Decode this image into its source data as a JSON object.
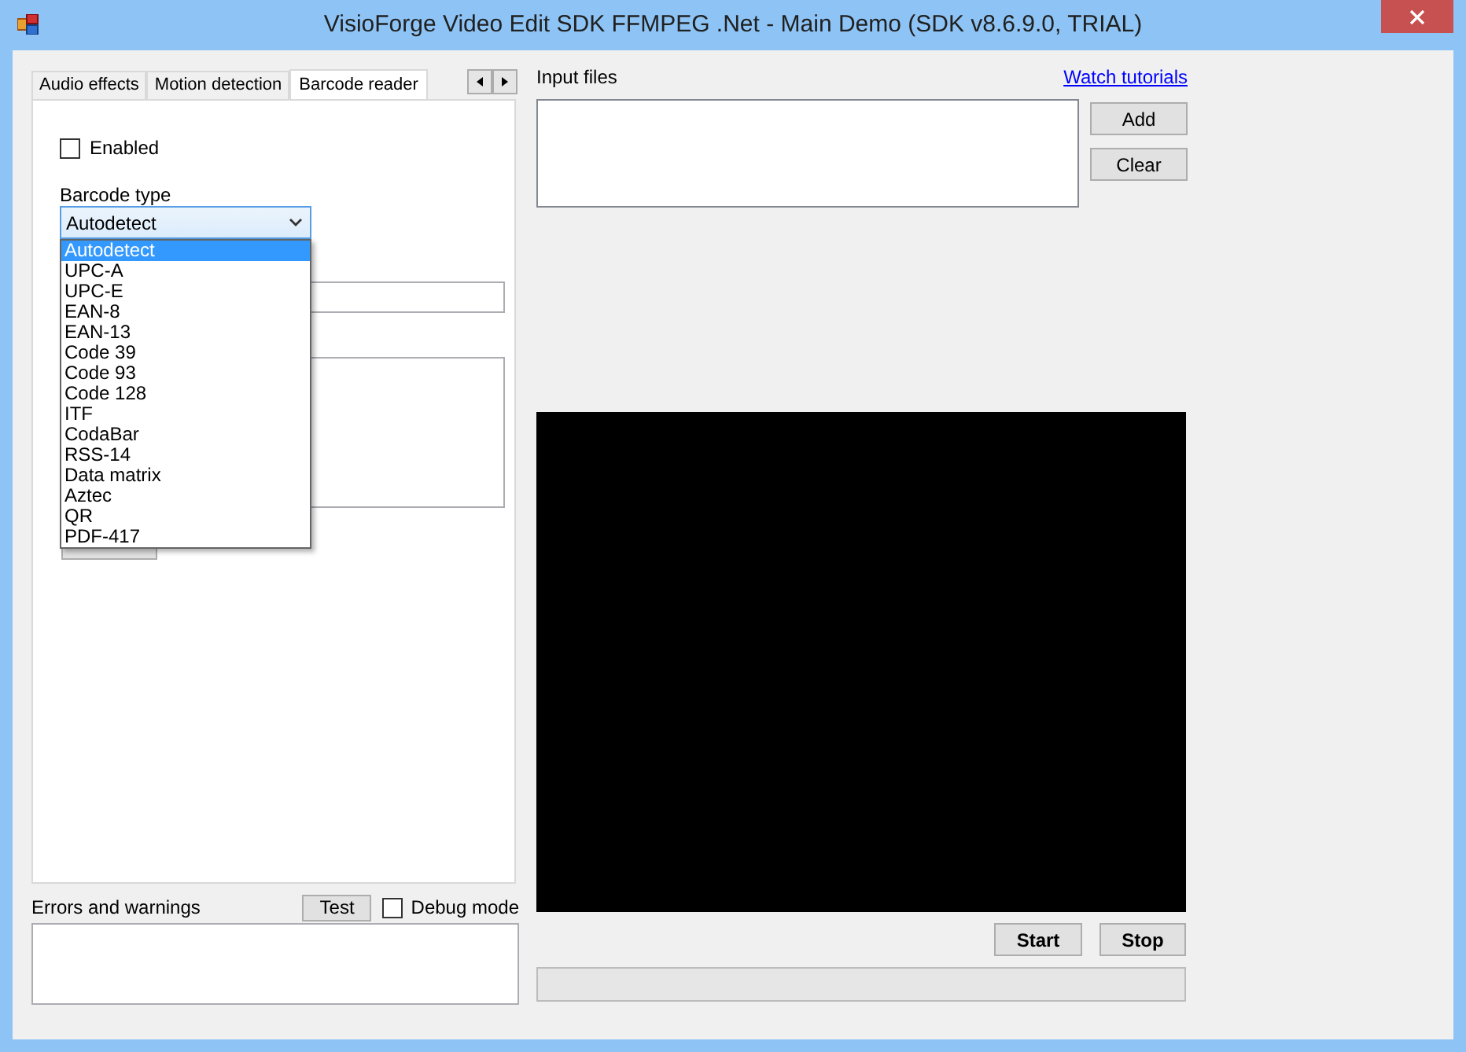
{
  "window": {
    "title": "VisioForge Video Edit SDK FFMPEG .Net - Main Demo (SDK v8.6.9.0, TRIAL)"
  },
  "tabs": [
    {
      "label": "Audio effects",
      "selected": false
    },
    {
      "label": "Motion detection",
      "selected": false
    },
    {
      "label": "Barcode reader",
      "selected": true
    }
  ],
  "barcode": {
    "enabled": {
      "label": "Enabled",
      "checked": false
    },
    "type_label": "Barcode type",
    "type_value": "Autodetect",
    "options": [
      {
        "label": "Autodetect",
        "selected": true
      },
      {
        "label": "UPC-A",
        "selected": false
      },
      {
        "label": "UPC-E",
        "selected": false
      },
      {
        "label": "EAN-8",
        "selected": false
      },
      {
        "label": "EAN-13",
        "selected": false
      },
      {
        "label": "Code 39",
        "selected": false
      },
      {
        "label": "Code 93",
        "selected": false
      },
      {
        "label": "Code 128",
        "selected": false
      },
      {
        "label": "ITF",
        "selected": false
      },
      {
        "label": "CodaBar",
        "selected": false
      },
      {
        "label": "RSS-14",
        "selected": false
      },
      {
        "label": "Data matrix",
        "selected": false
      },
      {
        "label": "Aztec",
        "selected": false
      },
      {
        "label": "QR",
        "selected": false
      },
      {
        "label": "PDF-417",
        "selected": false
      }
    ]
  },
  "errors": {
    "label": "Errors and warnings",
    "test_button": "Test",
    "debug": {
      "label": "Debug mode",
      "checked": false
    }
  },
  "input": {
    "label": "Input files",
    "link": "Watch tutorials",
    "buttons": [
      "Add",
      "Clear"
    ]
  },
  "controls": {
    "start": "Start",
    "stop": "Stop"
  },
  "progress": {
    "level": 0
  }
}
